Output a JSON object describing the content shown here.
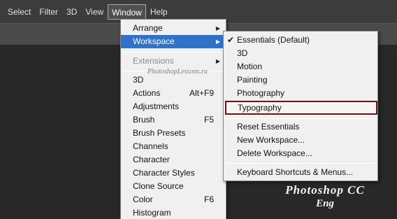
{
  "menubar": {
    "items": [
      "Select",
      "Filter",
      "3D",
      "View",
      "Window",
      "Help"
    ]
  },
  "window_menu": {
    "arrange": "Arrange",
    "workspace": "Workspace",
    "extensions": "Extensions",
    "watermark": "PhotoshopLessons.ru",
    "panels": [
      {
        "label": "3D",
        "shortcut": ""
      },
      {
        "label": "Actions",
        "shortcut": "Alt+F9"
      },
      {
        "label": "Adjustments",
        "shortcut": ""
      },
      {
        "label": "Brush",
        "shortcut": "F5"
      },
      {
        "label": "Brush Presets",
        "shortcut": ""
      },
      {
        "label": "Channels",
        "shortcut": ""
      },
      {
        "label": "Character",
        "shortcut": ""
      },
      {
        "label": "Character Styles",
        "shortcut": ""
      },
      {
        "label": "Clone Source",
        "shortcut": ""
      },
      {
        "label": "Color",
        "shortcut": "F6"
      },
      {
        "label": "Histogram",
        "shortcut": ""
      }
    ]
  },
  "workspace_menu": {
    "presets": [
      "Essentials (Default)",
      "3D",
      "Motion",
      "Painting",
      "Photography",
      "Typography"
    ],
    "checked": "Essentials (Default)",
    "actions": [
      "Reset Essentials",
      "New Workspace...",
      "Delete Workspace..."
    ],
    "shortcuts": "Keyboard Shortcuts & Menus..."
  },
  "brand": {
    "line1": "Photoshop  CC",
    "line2": "Eng"
  },
  "colors": {
    "highlight": "#3171c6",
    "menu_bg": "#f0f0f0",
    "app_bg": "#2b2b2b",
    "typography_box": "#6a1414"
  }
}
